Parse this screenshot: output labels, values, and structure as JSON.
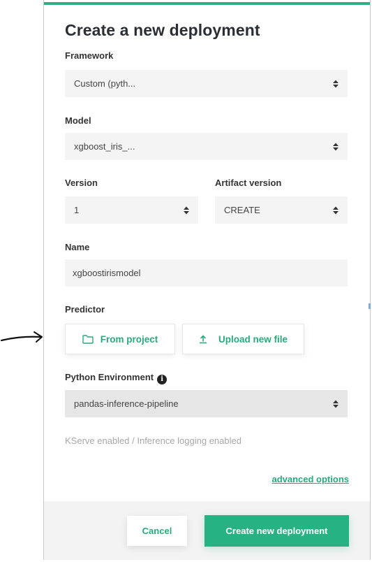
{
  "dialog": {
    "title": "Create a new deployment",
    "framework": {
      "label": "Framework",
      "value": "Custom (pyth..."
    },
    "model": {
      "label": "Model",
      "value": "xgboost_iris_..."
    },
    "version": {
      "label": "Version",
      "value": "1"
    },
    "artifact_version": {
      "label": "Artifact version",
      "value": "CREATE"
    },
    "name": {
      "label": "Name",
      "value": "xgboostirismodel"
    },
    "predictor": {
      "label": "Predictor",
      "from_project": "From project",
      "upload_new_file": "Upload new file"
    },
    "python_environment": {
      "label": "Python Environment",
      "info_icon": "i",
      "value": "pandas-inference-pipeline"
    },
    "hint": "KServe enabled / Inference logging enabled",
    "advanced_options": "advanced options",
    "footer": {
      "cancel": "Cancel",
      "create": "Create new deployment"
    }
  },
  "colors": {
    "accent": "#26b283",
    "accent_text": "#2aa97a"
  }
}
